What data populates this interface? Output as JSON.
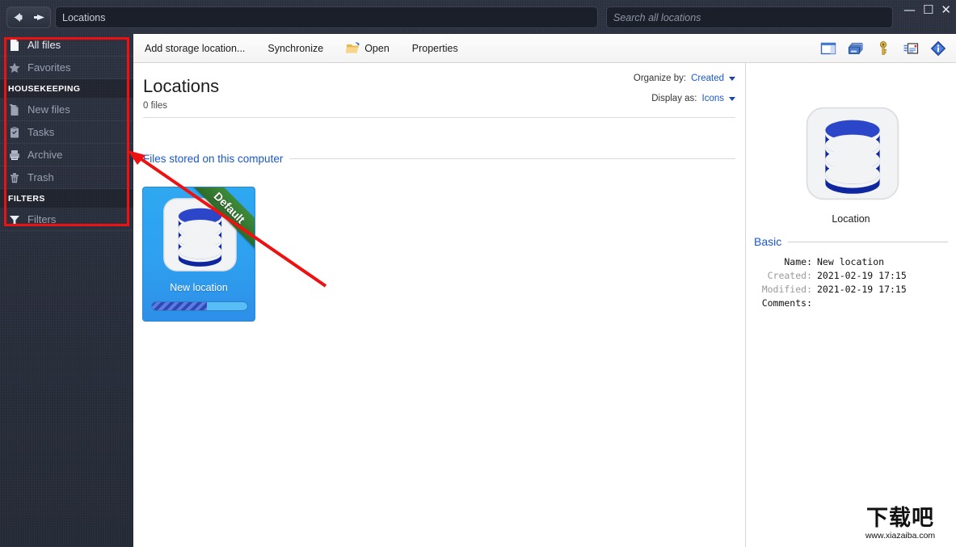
{
  "window": {
    "path_value": "Locations",
    "search_placeholder": "Search all locations",
    "minimize": "—",
    "maximize": "☐",
    "close": "✕"
  },
  "sidebar": {
    "items": [
      {
        "type": "item",
        "label": "All files",
        "icon": "document-icon",
        "active": true
      },
      {
        "type": "item",
        "label": "Favorites",
        "icon": "star-icon",
        "active": false
      },
      {
        "type": "head",
        "label": "HOUSEKEEPING"
      },
      {
        "type": "item",
        "label": "New files",
        "icon": "new-document-icon",
        "active": false
      },
      {
        "type": "item",
        "label": "Tasks",
        "icon": "clipboard-icon",
        "active": false
      },
      {
        "type": "item",
        "label": "Archive",
        "icon": "archive-icon",
        "active": false
      },
      {
        "type": "item",
        "label": "Trash",
        "icon": "trash-icon",
        "active": false
      },
      {
        "type": "head",
        "label": "FILTERS"
      },
      {
        "type": "item",
        "label": "Filters",
        "icon": "funnel-icon",
        "active": false
      }
    ]
  },
  "toolbar": {
    "add_storage_label": "Add storage location...",
    "synchronize_label": "Synchronize",
    "open_label": "Open",
    "properties_label": "Properties",
    "right_icons": [
      "panel-layout-icon",
      "cards-icon",
      "key-icon",
      "details-list-icon",
      "info-icon"
    ]
  },
  "content": {
    "title": "Locations",
    "file_count": "0 files",
    "organize_by_label": "Organize by:",
    "organize_by_value": "Created",
    "display_as_label": "Display as:",
    "display_as_value": "Icons",
    "group_label": "Files stored on this computer",
    "tile": {
      "name": "New location",
      "ribbon": "Default",
      "progress_percent": 58
    }
  },
  "details": {
    "icon_caption": "Location",
    "section_title": "Basic",
    "rows": [
      {
        "key": "Name:",
        "value": "New location",
        "dim": false
      },
      {
        "key": "Created:",
        "value": "2021-02-19 17:15",
        "dim": true
      },
      {
        "key": "Modified:",
        "value": "2021-02-19 17:15",
        "dim": true
      },
      {
        "key": "Comments:",
        "value": "",
        "dim": false
      }
    ]
  },
  "watermark": {
    "text_cn": "下载吧",
    "url": "www.xiazaiba.com"
  },
  "colors": {
    "accent_blue": "#1a57c8",
    "tile_blue": "#2ea0ef",
    "ribbon_green": "#3f8b3a",
    "annotation_red": "#ee1111",
    "chrome_dark": "#262b38"
  }
}
